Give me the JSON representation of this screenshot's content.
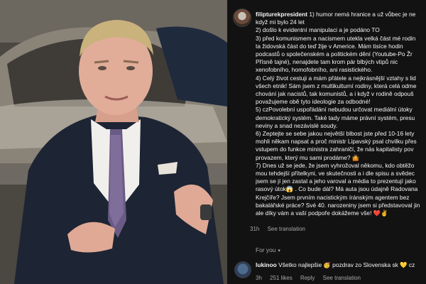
{
  "post": {
    "username": "filipturekpresident",
    "lines": [
      " 1) humor nemá hranice a už vůbec je ne",
      "když mi bylo 24 let",
      "2) došlo k evidentní manipulaci a je podáno TO",
      "3) před komunismem a nacismem utekla velká část mé rodin",
      "ta židovská část do teď žije v Americe. Mám tisíce hodin",
      "podcastů o společenském a politickém dění (Youtube-Po Žr",
      "Přísně tajné), nenajdete tam krom pár blbých vtipů nic",
      "xenofobního, homofobního, ani rasistického.",
      "4) Celý život cestuji a mám přátele a nejkrásnější vztahy s lid",
      "všech etnik! Sám jsem z multikulturní rodiny, která celá odme",
      "chování jak nacistů, tak komunistů, a i když v rodině odpouš",
      "považujeme obě tyto ideologie za odbodné!",
      "5) czPovolební uspořádání nebudou určovat mediální útoky",
      "demokratický systém. Také tady máme právní systém, presu",
      "neviny a snad nezávislé soudy.",
      "6) Zeptejte se sebe jakou největší blbost jste před 10-16 lety",
      "mohli někam napsat a proč ministr Lipavský psal chvilku přes",
      "vstupem do funkce ministra zahraničí, že nás kapitalisty pov",
      "provazem, který mu sami prodáme? 🤷",
      "7) Dnes už se jede, že jsem vyhrožoval někomu, kdo obtěžo",
      "mou tehdejší přítelkyni, ve skutečnosti a i dle spisu a svědec",
      "jsem se jí jen zastal a jeho varoval a média to prezentují jako",
      "rasový útok😱 . Co bude dál? Má auta jsou údajně Radovana",
      "Krejčíře? Jsem prvním nacistickým íránským agentem bez",
      "bakalářské práce? Své 40. narozeniny jsem si představoval jin",
      "ale díky vám a vaší podpoře dokážeme vše! ❤️✌️"
    ],
    "age": "31h",
    "see_translation": "See translation"
  },
  "section_label": "For you",
  "comment": {
    "username": "lukinoo",
    "text": " Všetko najlepšie 🥳 pozdrav zo Slovenska sk 💛 cz",
    "age": "3h",
    "likes": "251 likes",
    "reply": "Reply",
    "see_translation": "See translation"
  },
  "colors": {
    "panel_bg": "#121212",
    "text": "#f5f5f5",
    "muted": "#a8a8a8"
  },
  "icons": [
    "profile-avatar",
    "chevron-down-icon",
    "commenter-avatar"
  ]
}
